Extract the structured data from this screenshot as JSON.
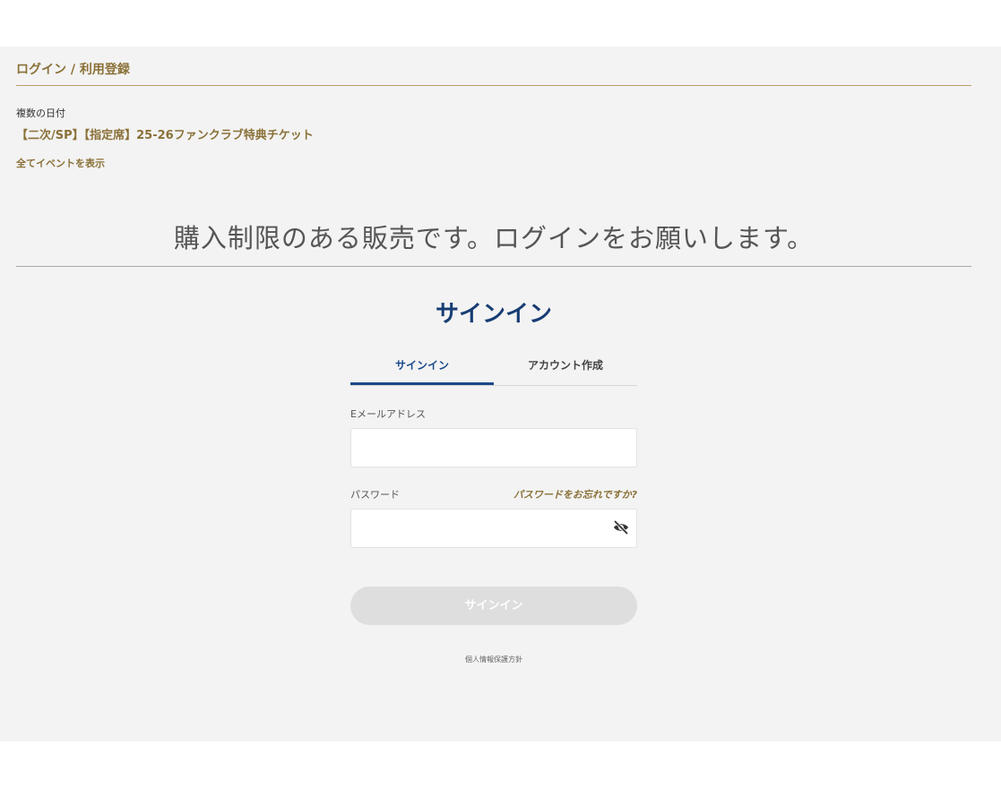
{
  "section_title": "ログイン / 利用登録",
  "event": {
    "date_label": "複数の日付",
    "name": "【二次/SP】【指定席】25-26ファンクラブ特典チケット",
    "all_events_link": "全てイベントを表示"
  },
  "notice": "購入制限のある販売です。ログインをお願いします。",
  "signin": {
    "heading": "サインイン",
    "tabs": [
      "サインイン",
      "アカウント作成"
    ],
    "active_tab": "サインイン",
    "email_label": "Eメールアドレス",
    "email_value": "",
    "password_label": "パスワード",
    "password_value": "",
    "forgot_link": "パスワードをお忘れですか?",
    "password_toggle_icon": "eye-slash-icon",
    "submit_label": "サインイン",
    "submit_state": "disabled",
    "privacy_link": "個人情報保護方針"
  },
  "colors": {
    "gold": "#8a7138",
    "navy": "#173d73",
    "tab_accent": "#1a4a8a",
    "panel_bg": "#f3f3f3",
    "button_disabled": "#dedede"
  }
}
